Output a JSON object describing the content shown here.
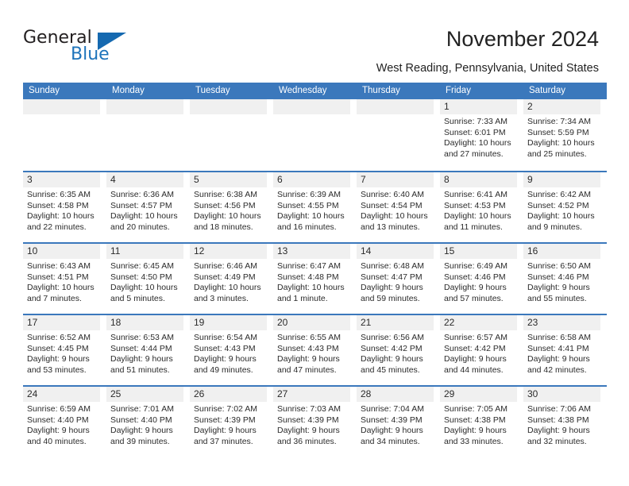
{
  "brand": {
    "name_part1": "General",
    "name_part2": "Blue",
    "flag_icon": "triangle-flag-icon",
    "color_primary": "#1569b0",
    "color_text": "#231f20"
  },
  "header": {
    "title": "November 2024",
    "location": "West Reading, Pennsylvania, United States"
  },
  "calendar": {
    "header_bg": "#3b78bc",
    "day_band_bg": "#f0f0f0",
    "weekdays": [
      "Sunday",
      "Monday",
      "Tuesday",
      "Wednesday",
      "Thursday",
      "Friday",
      "Saturday"
    ],
    "weeks": [
      [
        {
          "day": "",
          "empty": true
        },
        {
          "day": "",
          "empty": true
        },
        {
          "day": "",
          "empty": true
        },
        {
          "day": "",
          "empty": true
        },
        {
          "day": "",
          "empty": true
        },
        {
          "day": "1",
          "sunrise": "Sunrise: 7:33 AM",
          "sunset": "Sunset: 6:01 PM",
          "daylight": "Daylight: 10 hours and 27 minutes."
        },
        {
          "day": "2",
          "sunrise": "Sunrise: 7:34 AM",
          "sunset": "Sunset: 5:59 PM",
          "daylight": "Daylight: 10 hours and 25 minutes."
        }
      ],
      [
        {
          "day": "3",
          "sunrise": "Sunrise: 6:35 AM",
          "sunset": "Sunset: 4:58 PM",
          "daylight": "Daylight: 10 hours and 22 minutes."
        },
        {
          "day": "4",
          "sunrise": "Sunrise: 6:36 AM",
          "sunset": "Sunset: 4:57 PM",
          "daylight": "Daylight: 10 hours and 20 minutes."
        },
        {
          "day": "5",
          "sunrise": "Sunrise: 6:38 AM",
          "sunset": "Sunset: 4:56 PM",
          "daylight": "Daylight: 10 hours and 18 minutes."
        },
        {
          "day": "6",
          "sunrise": "Sunrise: 6:39 AM",
          "sunset": "Sunset: 4:55 PM",
          "daylight": "Daylight: 10 hours and 16 minutes."
        },
        {
          "day": "7",
          "sunrise": "Sunrise: 6:40 AM",
          "sunset": "Sunset: 4:54 PM",
          "daylight": "Daylight: 10 hours and 13 minutes."
        },
        {
          "day": "8",
          "sunrise": "Sunrise: 6:41 AM",
          "sunset": "Sunset: 4:53 PM",
          "daylight": "Daylight: 10 hours and 11 minutes."
        },
        {
          "day": "9",
          "sunrise": "Sunrise: 6:42 AM",
          "sunset": "Sunset: 4:52 PM",
          "daylight": "Daylight: 10 hours and 9 minutes."
        }
      ],
      [
        {
          "day": "10",
          "sunrise": "Sunrise: 6:43 AM",
          "sunset": "Sunset: 4:51 PM",
          "daylight": "Daylight: 10 hours and 7 minutes."
        },
        {
          "day": "11",
          "sunrise": "Sunrise: 6:45 AM",
          "sunset": "Sunset: 4:50 PM",
          "daylight": "Daylight: 10 hours and 5 minutes."
        },
        {
          "day": "12",
          "sunrise": "Sunrise: 6:46 AM",
          "sunset": "Sunset: 4:49 PM",
          "daylight": "Daylight: 10 hours and 3 minutes."
        },
        {
          "day": "13",
          "sunrise": "Sunrise: 6:47 AM",
          "sunset": "Sunset: 4:48 PM",
          "daylight": "Daylight: 10 hours and 1 minute."
        },
        {
          "day": "14",
          "sunrise": "Sunrise: 6:48 AM",
          "sunset": "Sunset: 4:47 PM",
          "daylight": "Daylight: 9 hours and 59 minutes."
        },
        {
          "day": "15",
          "sunrise": "Sunrise: 6:49 AM",
          "sunset": "Sunset: 4:46 PM",
          "daylight": "Daylight: 9 hours and 57 minutes."
        },
        {
          "day": "16",
          "sunrise": "Sunrise: 6:50 AM",
          "sunset": "Sunset: 4:46 PM",
          "daylight": "Daylight: 9 hours and 55 minutes."
        }
      ],
      [
        {
          "day": "17",
          "sunrise": "Sunrise: 6:52 AM",
          "sunset": "Sunset: 4:45 PM",
          "daylight": "Daylight: 9 hours and 53 minutes."
        },
        {
          "day": "18",
          "sunrise": "Sunrise: 6:53 AM",
          "sunset": "Sunset: 4:44 PM",
          "daylight": "Daylight: 9 hours and 51 minutes."
        },
        {
          "day": "19",
          "sunrise": "Sunrise: 6:54 AM",
          "sunset": "Sunset: 4:43 PM",
          "daylight": "Daylight: 9 hours and 49 minutes."
        },
        {
          "day": "20",
          "sunrise": "Sunrise: 6:55 AM",
          "sunset": "Sunset: 4:43 PM",
          "daylight": "Daylight: 9 hours and 47 minutes."
        },
        {
          "day": "21",
          "sunrise": "Sunrise: 6:56 AM",
          "sunset": "Sunset: 4:42 PM",
          "daylight": "Daylight: 9 hours and 45 minutes."
        },
        {
          "day": "22",
          "sunrise": "Sunrise: 6:57 AM",
          "sunset": "Sunset: 4:42 PM",
          "daylight": "Daylight: 9 hours and 44 minutes."
        },
        {
          "day": "23",
          "sunrise": "Sunrise: 6:58 AM",
          "sunset": "Sunset: 4:41 PM",
          "daylight": "Daylight: 9 hours and 42 minutes."
        }
      ],
      [
        {
          "day": "24",
          "sunrise": "Sunrise: 6:59 AM",
          "sunset": "Sunset: 4:40 PM",
          "daylight": "Daylight: 9 hours and 40 minutes."
        },
        {
          "day": "25",
          "sunrise": "Sunrise: 7:01 AM",
          "sunset": "Sunset: 4:40 PM",
          "daylight": "Daylight: 9 hours and 39 minutes."
        },
        {
          "day": "26",
          "sunrise": "Sunrise: 7:02 AM",
          "sunset": "Sunset: 4:39 PM",
          "daylight": "Daylight: 9 hours and 37 minutes."
        },
        {
          "day": "27",
          "sunrise": "Sunrise: 7:03 AM",
          "sunset": "Sunset: 4:39 PM",
          "daylight": "Daylight: 9 hours and 36 minutes."
        },
        {
          "day": "28",
          "sunrise": "Sunrise: 7:04 AM",
          "sunset": "Sunset: 4:39 PM",
          "daylight": "Daylight: 9 hours and 34 minutes."
        },
        {
          "day": "29",
          "sunrise": "Sunrise: 7:05 AM",
          "sunset": "Sunset: 4:38 PM",
          "daylight": "Daylight: 9 hours and 33 minutes."
        },
        {
          "day": "30",
          "sunrise": "Sunrise: 7:06 AM",
          "sunset": "Sunset: 4:38 PM",
          "daylight": "Daylight: 9 hours and 32 minutes."
        }
      ]
    ]
  }
}
